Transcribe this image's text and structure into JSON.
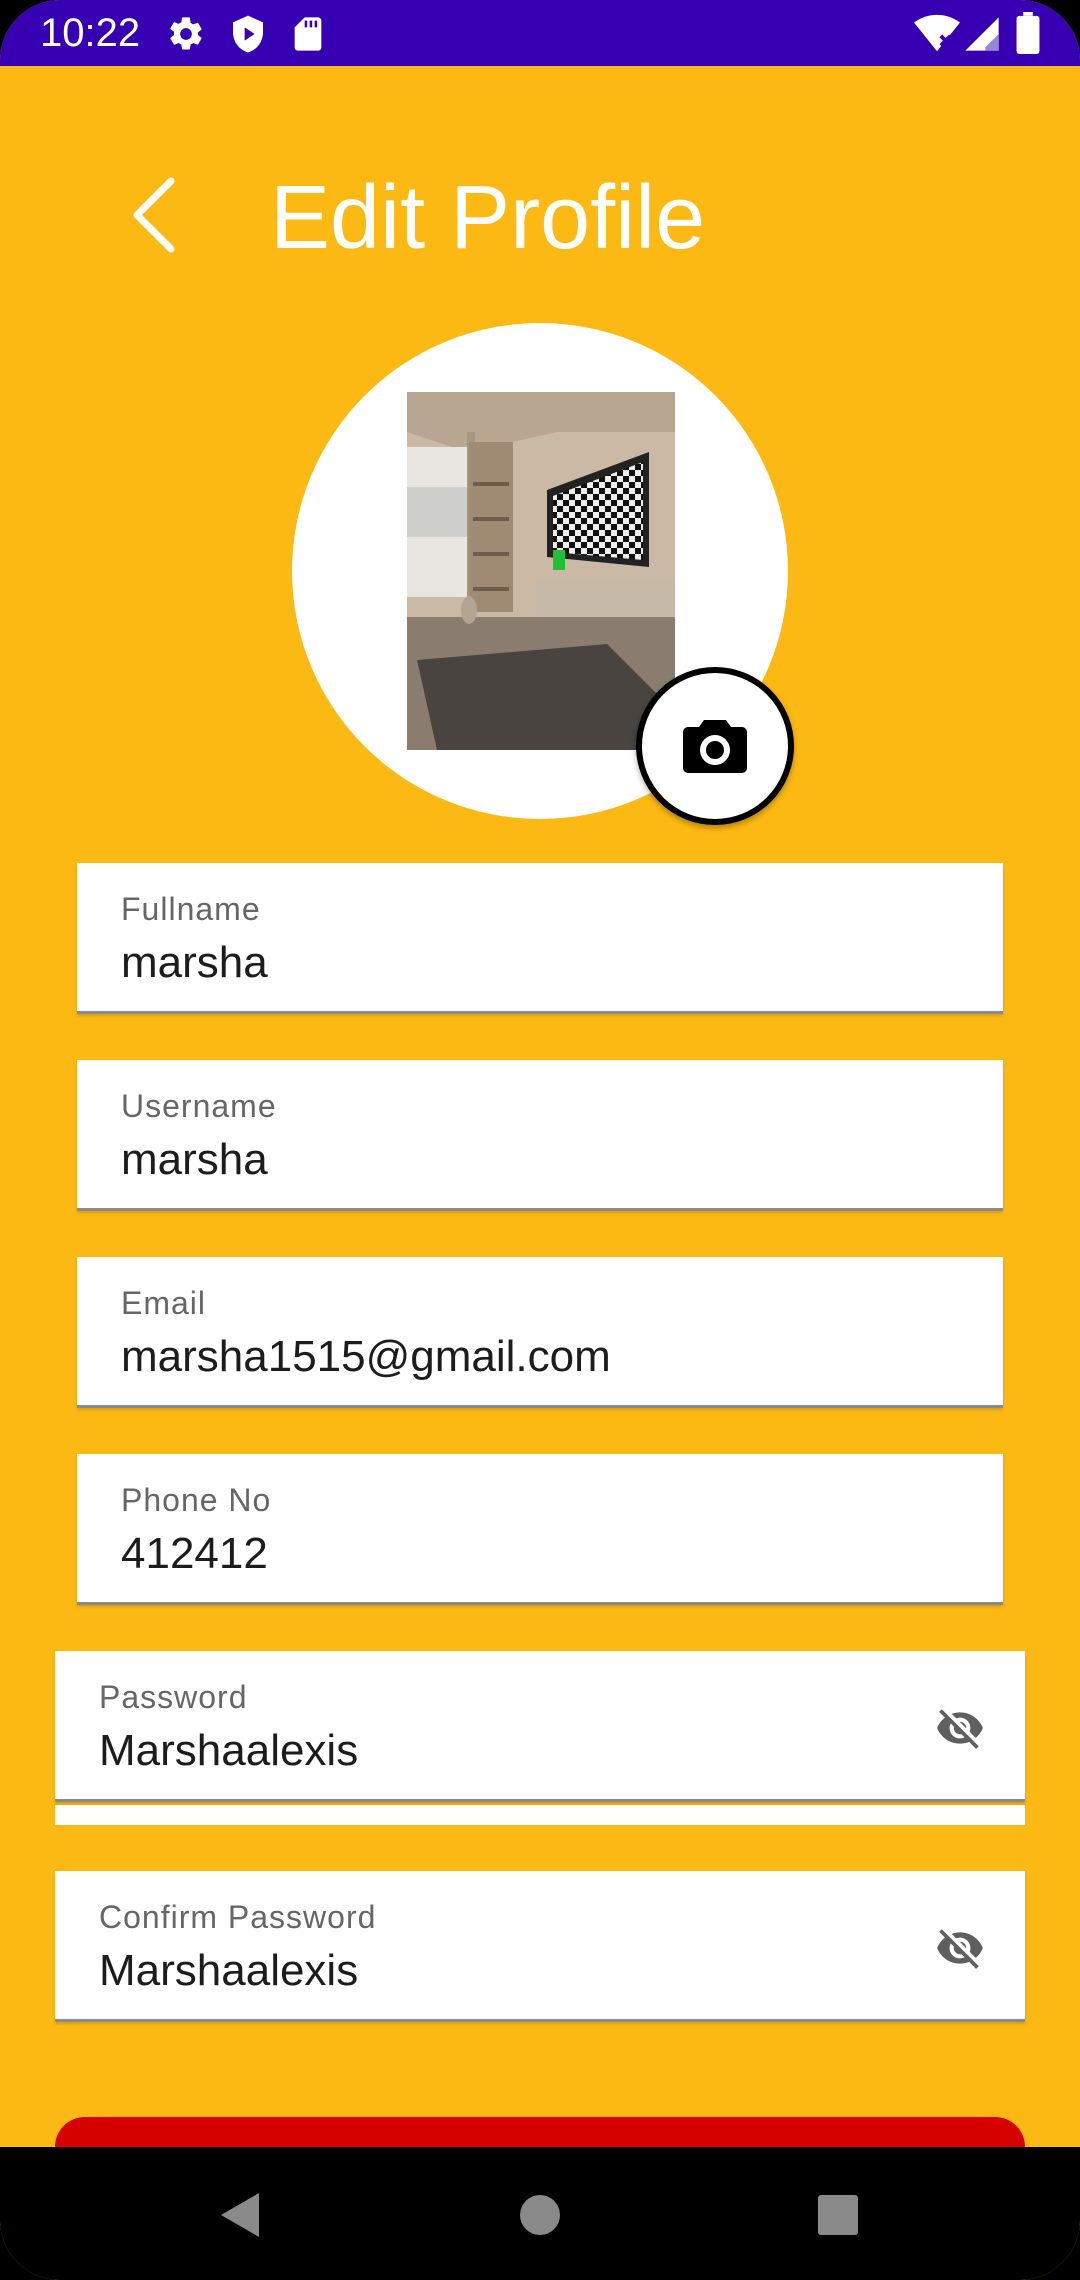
{
  "status_bar": {
    "time": "10:22",
    "left_icons": [
      "settings-icon",
      "shield-icon",
      "sd-card-icon"
    ],
    "right_icons": [
      "wifi-icon",
      "signal-icon",
      "battery-icon"
    ],
    "background": "#3700B3"
  },
  "header": {
    "back_icon": "chevron-left-icon",
    "title": "Edit Profile"
  },
  "avatar": {
    "camera_icon": "camera-icon"
  },
  "fields": {
    "fullname": {
      "label": "Fullname",
      "value": "marsha"
    },
    "username": {
      "label": "Username",
      "value": "marsha"
    },
    "email": {
      "label": "Email",
      "value": "marsha1515@gmail.com"
    },
    "phone": {
      "label": "Phone No",
      "value": "412412"
    },
    "password": {
      "label": "Password",
      "value": "Marshaalexis",
      "toggle_icon": "eye-off-icon"
    },
    "confirm_password": {
      "label": "Confirm Password",
      "value": "Marshaalexis",
      "toggle_icon": "eye-off-icon"
    }
  },
  "colors": {
    "background": "#FDB913",
    "status_bar": "#3700B3",
    "save_button": "#D60000",
    "title_text": "#FFFFFF"
  },
  "nav_bar": {
    "icons": [
      "back-triangle-icon",
      "home-circle-icon",
      "recents-square-icon"
    ]
  }
}
